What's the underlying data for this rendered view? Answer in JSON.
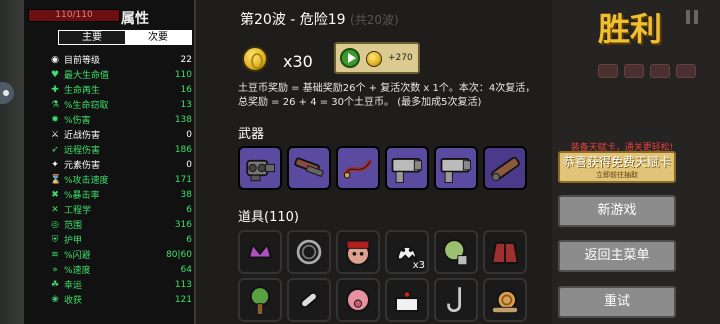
{
  "hud": {
    "hp_text": "110/110"
  },
  "stats": {
    "title": "属性",
    "tabs": [
      {
        "label": "主要",
        "active": true
      },
      {
        "label": "次要",
        "active": false
      }
    ],
    "rows": [
      {
        "icon": "level-icon",
        "glyph": "◉",
        "color": "#ffffff",
        "label": "目前等级",
        "value": "22"
      },
      {
        "icon": "heart-icon",
        "glyph": "♥",
        "color": "#3de06b",
        "label": "最大生命值",
        "value": "110"
      },
      {
        "icon": "regen-icon",
        "glyph": "✚",
        "color": "#3de06b",
        "label": "生命再生",
        "value": "16"
      },
      {
        "icon": "lifesteal-icon",
        "glyph": "⚗",
        "color": "#3de06b",
        "label": "%生命窃取",
        "value": "13"
      },
      {
        "icon": "damage-icon",
        "glyph": "✹",
        "color": "#3de06b",
        "label": "%伤害",
        "value": "138"
      },
      {
        "icon": "melee-icon",
        "glyph": "⚔",
        "color": "#ffffff",
        "label": "近战伤害",
        "value": "0"
      },
      {
        "icon": "ranged-icon",
        "glyph": "➶",
        "color": "#3de06b",
        "label": "远程伤害",
        "value": "186"
      },
      {
        "icon": "elemental-icon",
        "glyph": "✦",
        "color": "#ffffff",
        "label": "元素伤害",
        "value": "0"
      },
      {
        "icon": "attack-speed-icon",
        "glyph": "⌛",
        "color": "#3de06b",
        "label": "%攻击速度",
        "value": "171"
      },
      {
        "icon": "crit-icon",
        "glyph": "✖",
        "color": "#3de06b",
        "label": "%暴击率",
        "value": "38"
      },
      {
        "icon": "engineering-icon",
        "glyph": "✕",
        "color": "#3de06b",
        "label": "工程学",
        "value": "6"
      },
      {
        "icon": "range-icon",
        "glyph": "◎",
        "color": "#3de06b",
        "label": "范围",
        "value": "316"
      },
      {
        "icon": "armor-icon",
        "glyph": "⛨",
        "color": "#3de06b",
        "label": "护甲",
        "value": "6"
      },
      {
        "icon": "dodge-icon",
        "glyph": "≋",
        "color": "#3de06b",
        "label": "%闪避",
        "value": "80|60"
      },
      {
        "icon": "speed-icon",
        "glyph": "»",
        "color": "#3de06b",
        "label": "%速度",
        "value": "64"
      },
      {
        "icon": "luck-icon",
        "glyph": "☘",
        "color": "#3de06b",
        "label": "幸运",
        "value": "113"
      },
      {
        "icon": "harvest-icon",
        "glyph": "❀",
        "color": "#3de06b",
        "label": "收获",
        "value": "121"
      }
    ]
  },
  "run": {
    "wave_title": "第20波 - 危险19",
    "wave_total": "(共20波)",
    "coin_count": "x30",
    "bonus_value": "+270",
    "explain_line1": "土豆币奖励 = 基础奖励26个 + 复活次数 x 1个。本次：4次复活，",
    "explain_line2": "总奖励 = 26 + 4 = 30个土豆币。 (最多加成5次复活)",
    "weapons_title": "武器",
    "items_title": "道具(110)",
    "item_count_label": "x3"
  },
  "right": {
    "victory": "胜利",
    "talent_note": "装备天赋卡，通关更轻松!",
    "talent_button": "恭喜获得免费天赋卡",
    "talent_sub": "立即前往抽取",
    "new_game": "新游戏",
    "main_menu": "返回主菜单",
    "retry": "重试"
  },
  "colors": {
    "accent_gold": "#f0c030",
    "stat_green": "#3de06b",
    "weapon_slot": "#5a4aa0"
  }
}
